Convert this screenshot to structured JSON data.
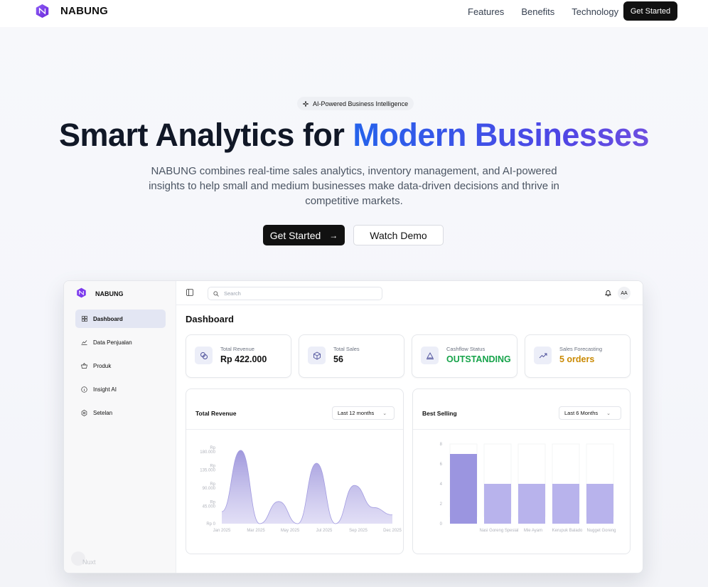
{
  "nav": {
    "brand": "NABUNG",
    "links": [
      "Features",
      "Benefits",
      "Technology"
    ],
    "cta": "Get Started"
  },
  "hero": {
    "badge": "AI-Powered Business Intelligence",
    "headline_part1": "Smart Analytics for ",
    "headline_part2": "Modern Businesses",
    "subtext": "NABUNG combines real-time sales analytics, inventory management, and AI-powered insights to help small and medium businesses make data-driven decisions and thrive in competitive markets.",
    "primary_cta": "Get Started",
    "secondary_cta": "Watch Demo"
  },
  "dashboard": {
    "brand": "NABUNG",
    "sidebar": [
      {
        "label": "Dashboard",
        "icon": "grid-icon",
        "active": true
      },
      {
        "label": "Data Penjualan",
        "icon": "chart-icon",
        "active": false
      },
      {
        "label": "Produk",
        "icon": "basket-icon",
        "active": false
      },
      {
        "label": "Insight AI",
        "icon": "info-icon",
        "active": false
      },
      {
        "label": "Setelan",
        "icon": "gear-icon",
        "active": false
      }
    ],
    "footer_text": "Nuxt",
    "search_placeholder": "Search",
    "avatar": "AA",
    "title": "Dashboard",
    "stats": [
      {
        "label": "Total Revenue",
        "value": "Rp 422.000",
        "icon": "coins-icon",
        "color": "#111111"
      },
      {
        "label": "Total Sales",
        "value": "56",
        "icon": "box-icon",
        "color": "#111111"
      },
      {
        "label": "Cashflow Status",
        "value": "OUTSTANDING",
        "icon": "scale-icon",
        "color": "#16a34a"
      },
      {
        "label": "Sales Forecasting",
        "value": "5 orders",
        "icon": "trend-icon",
        "color": "#ca8a04"
      }
    ],
    "revenue_chart": {
      "title": "Total Revenue",
      "range": "Last 12 months"
    },
    "best_chart": {
      "title": "Best Selling",
      "range": "Last 6 Months"
    }
  },
  "chart_data": [
    {
      "type": "area",
      "title": "Total Revenue",
      "x": [
        "Jan 2025",
        "Mar 2025",
        "May 2025",
        "Jul 2025",
        "Sep 2025",
        "Dec 2025"
      ],
      "y_ticks": [
        "Rp 0",
        "Rp 45.000",
        "Rp 90.000",
        "Rp 135.000",
        "Rp 180.000"
      ],
      "ylim": [
        0,
        180000
      ],
      "series": [
        {
          "values": [
            30000,
            182000,
            0,
            55000,
            0,
            150000,
            0,
            95000,
            40000,
            22000
          ]
        }
      ]
    },
    {
      "type": "bar",
      "title": "Best Selling",
      "categories": [
        "",
        "Nasi Goreng Spesial",
        "Mie Ayam",
        "Kerupuk Balado",
        "Nugget Goreng"
      ],
      "values": [
        7,
        4,
        4,
        4,
        4
      ],
      "y_ticks": [
        "0",
        "2",
        "4",
        "6",
        "8"
      ],
      "ylim": [
        0,
        8
      ]
    }
  ]
}
